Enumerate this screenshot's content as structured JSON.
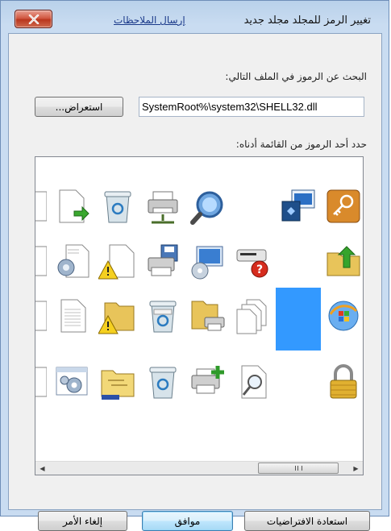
{
  "window": {
    "title": "تغيير الرمز للمجلد مجلد جديد",
    "feedback_link": "إرسال الملاحظات",
    "close_icon": "close-x-icon"
  },
  "search": {
    "label": "البحث عن الرموز في الملف التالي:",
    "path_value": "SystemRoot%\\system32\\SHELL32.dll",
    "browse_label": "استعراض..."
  },
  "icons": {
    "label": "حدد أحد الرموز من القائمة أدناه:",
    "rows": [
      [
        "key-icon",
        "display-settings-icon",
        "",
        "magnifier-icon",
        "printer-network-icon",
        "recycle-bin-icon",
        "document-arrow-icon",
        "partial-document-icon"
      ],
      [
        "folder-up-arrow-icon",
        "",
        "help-device-icon",
        "monitor-disk-icon",
        "printer-save-icon",
        "warning-document-icon",
        "settings-document-icon",
        "partial-document-icon"
      ],
      [
        "windows-globe-icon",
        "",
        "copy-documents-icon",
        "folder-printer-icon",
        "recycle-bin-full-icon",
        "warning-folder-icon",
        "text-document-icon",
        "partial-document-icon"
      ],
      [
        "padlock-icon",
        "",
        "search-document-icon",
        "add-printer-icon",
        "recycle-bin-icon",
        "folder-tree-icon",
        "settings-window-icon",
        "partial-document-icon"
      ]
    ],
    "selected_row": 2,
    "selected_col": 1
  },
  "scrollbar": {
    "left_arrow": "◀",
    "right_arrow": "▶"
  },
  "buttons": {
    "restore": "استعادة الافتراضيات",
    "ok": "موافق",
    "cancel": "إلغاء الأمر"
  }
}
